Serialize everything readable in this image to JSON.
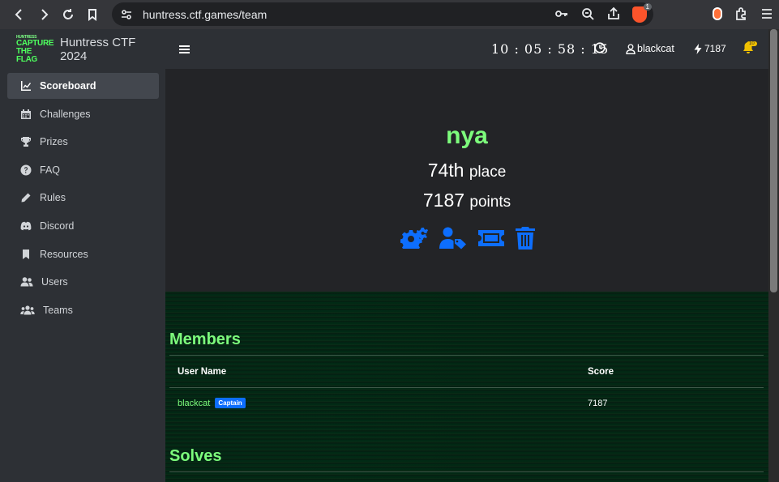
{
  "browser": {
    "url": "huntress.ctf.games/team",
    "brave_badge": "1"
  },
  "brand": {
    "logo_small": "HUNTRESS",
    "logo_line1": "CAPTURE",
    "logo_line2": "THE FLAG",
    "title": "Huntress CTF 2024"
  },
  "sidebar": {
    "items": [
      {
        "label": "Scoreboard",
        "icon": "chart-line-icon"
      },
      {
        "label": "Challenges",
        "icon": "calendar-icon"
      },
      {
        "label": "Prizes",
        "icon": "trophy-icon"
      },
      {
        "label": "FAQ",
        "icon": "question-circle-icon"
      },
      {
        "label": "Rules",
        "icon": "pen-icon"
      },
      {
        "label": "Discord",
        "icon": "discord-icon"
      },
      {
        "label": "Resources",
        "icon": "bookmark-icon"
      },
      {
        "label": "Users",
        "icon": "users-icon"
      },
      {
        "label": "Teams",
        "icon": "users-group-icon"
      }
    ]
  },
  "topbar": {
    "timer": "10 : 05 : 58 : 15",
    "username": "blackcat",
    "points": "7187",
    "bell_badge": "10"
  },
  "team": {
    "name": "nya",
    "place_number": "74th",
    "place_label": "place",
    "points_number": "7187",
    "points_label": "points"
  },
  "members": {
    "title": "Members",
    "headers": [
      "User Name",
      "Score"
    ],
    "rows": [
      {
        "name": "blackcat",
        "badge": "Captain",
        "score": "7187"
      }
    ]
  },
  "solves": {
    "title": "Solves"
  }
}
